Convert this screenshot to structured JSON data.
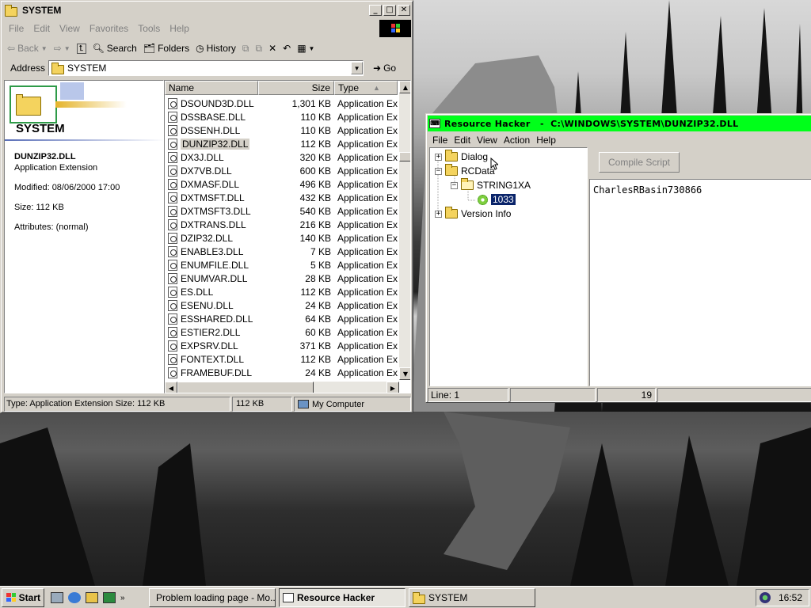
{
  "explorer": {
    "title": "SYSTEM",
    "menu": [
      "File",
      "Edit",
      "View",
      "Favorites",
      "Tools",
      "Help"
    ],
    "toolbar": {
      "back": "Back",
      "search": "Search",
      "folders": "Folders",
      "history": "History"
    },
    "address_label": "Address",
    "address_value": "SYSTEM",
    "go": "Go",
    "info": {
      "folder_name": "SYSTEM",
      "file_name": "DUNZIP32.DLL",
      "file_type": "Application Extension",
      "modified": "Modified: 08/06/2000 17:00",
      "size": "Size: 112 KB",
      "attributes": "Attributes: (normal)"
    },
    "columns": {
      "name": "Name",
      "size": "Size",
      "type": "Type"
    },
    "files": [
      {
        "name": "DSOUND3D.DLL",
        "size": "1,301 KB",
        "type": "Application Exte"
      },
      {
        "name": "DSSBASE.DLL",
        "size": "110 KB",
        "type": "Application Exte"
      },
      {
        "name": "DSSENH.DLL",
        "size": "110 KB",
        "type": "Application Exte"
      },
      {
        "name": "DUNZIP32.DLL",
        "size": "112 KB",
        "type": "Application Exte"
      },
      {
        "name": "DX3J.DLL",
        "size": "320 KB",
        "type": "Application Exte"
      },
      {
        "name": "DX7VB.DLL",
        "size": "600 KB",
        "type": "Application Exte"
      },
      {
        "name": "DXMASF.DLL",
        "size": "496 KB",
        "type": "Application Exte"
      },
      {
        "name": "DXTMSFT.DLL",
        "size": "432 KB",
        "type": "Application Exte"
      },
      {
        "name": "DXTMSFT3.DLL",
        "size": "540 KB",
        "type": "Application Exte"
      },
      {
        "name": "DXTRANS.DLL",
        "size": "216 KB",
        "type": "Application Exte"
      },
      {
        "name": "DZIP32.DLL",
        "size": "140 KB",
        "type": "Application Exte"
      },
      {
        "name": "ENABLE3.DLL",
        "size": "7 KB",
        "type": "Application Exte"
      },
      {
        "name": "ENUMFILE.DLL",
        "size": "5 KB",
        "type": "Application Exte"
      },
      {
        "name": "ENUMVAR.DLL",
        "size": "28 KB",
        "type": "Application Exte"
      },
      {
        "name": "ES.DLL",
        "size": "112 KB",
        "type": "Application Exte"
      },
      {
        "name": "ESENU.DLL",
        "size": "24 KB",
        "type": "Application Exte"
      },
      {
        "name": "ESSHARED.DLL",
        "size": "64 KB",
        "type": "Application Exte"
      },
      {
        "name": "ESTIER2.DLL",
        "size": "60 KB",
        "type": "Application Exte"
      },
      {
        "name": "EXPSRV.DLL",
        "size": "371 KB",
        "type": "Application Exte"
      },
      {
        "name": "FONTEXT.DLL",
        "size": "112 KB",
        "type": "Application Exte"
      },
      {
        "name": "FRAMEBUF.DLL",
        "size": "24 KB",
        "type": "Application Exte"
      }
    ],
    "selected_index": 3,
    "status": {
      "type_size": "Type: Application Extension Size: 112 KB",
      "size": "112 KB",
      "zone": "My Computer"
    }
  },
  "reshacker": {
    "title": "Resource Hacker   -  C:\\WINDOWS\\SYSTEM\\DUNZIP32.DLL",
    "menu": [
      "File",
      "Edit",
      "View",
      "Action",
      "Help"
    ],
    "tree": {
      "dialog": "Dialog",
      "rcdata": "RCData",
      "string1xa": "STRING1XA",
      "item_1033": "1033",
      "version_info": "Version Info"
    },
    "compile_button": "Compile Script",
    "editor_text": "CharlesRBasin730866",
    "status": {
      "line": "Line: 1",
      "col": "19"
    }
  },
  "taskbar": {
    "start": "Start",
    "tasks": [
      "Problem loading page - Mo...",
      "Resource Hacker",
      "SYSTEM"
    ],
    "clock": "16:52"
  }
}
